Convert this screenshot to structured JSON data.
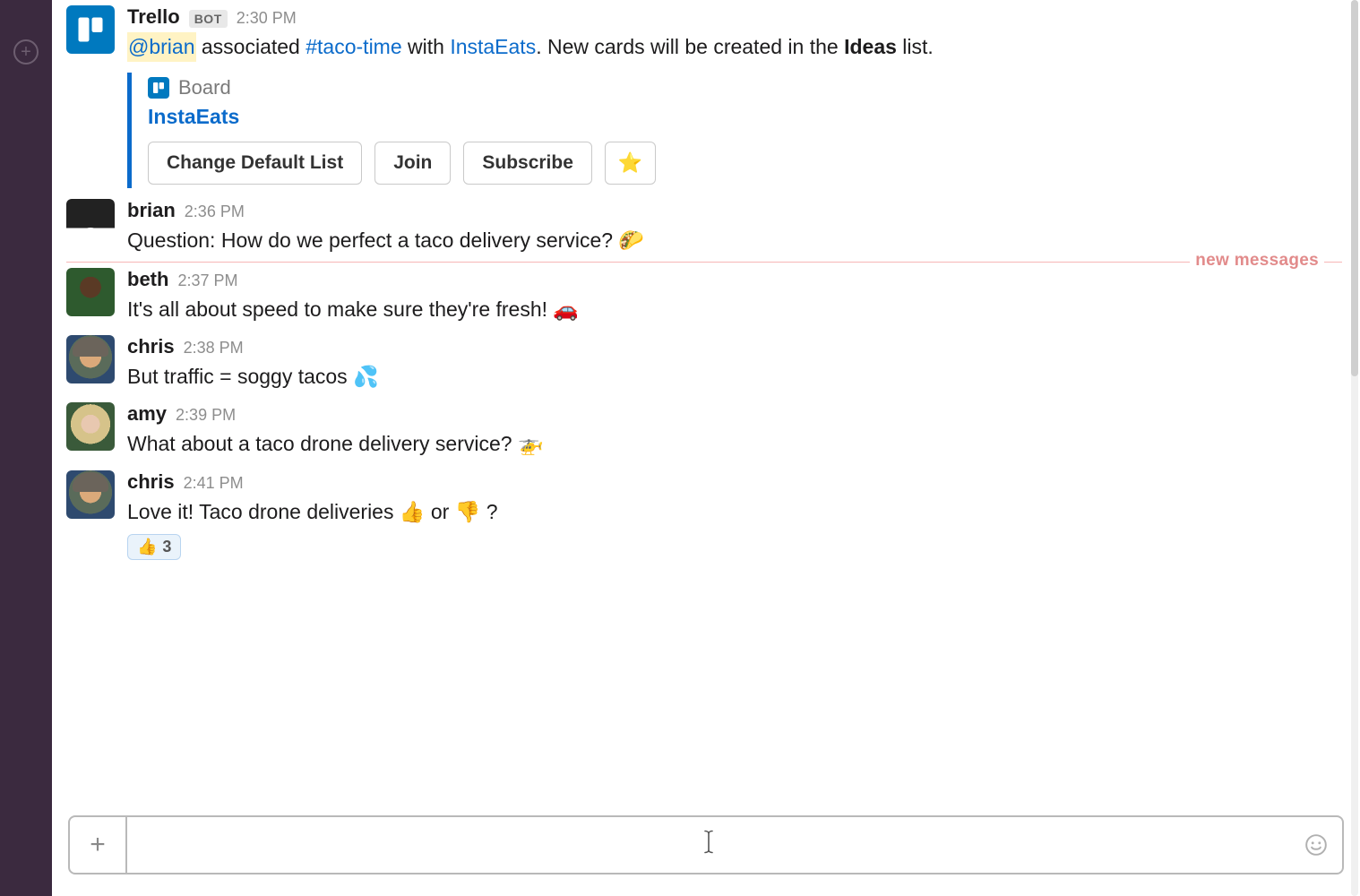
{
  "sidebar": {
    "add_label": "+"
  },
  "messages": [
    {
      "id": "m0",
      "author": "Trello",
      "is_app": true,
      "app_badge": "BOT",
      "time": "2:30 PM",
      "avatar": "trello",
      "rich_text": {
        "mention": "@brian",
        "t1": " associated ",
        "channel": "#taco-time",
        "t2": " with ",
        "link": "InstaEats",
        "t3": ". New cards will be created in the ",
        "bold": "Ideas",
        "t4": " list."
      },
      "attachment": {
        "icon": "trello",
        "type_label": "Board",
        "name": "InstaEats",
        "buttons": {
          "change": "Change Default List",
          "join": "Join",
          "subscribe": "Subscribe",
          "star": "⭐"
        }
      }
    },
    {
      "id": "m1",
      "author": "brian",
      "time": "2:36 PM",
      "avatar": "brian",
      "text": "Question: How do we perfect a taco delivery service? 🌮"
    }
  ],
  "new_divider": {
    "label": "new messages"
  },
  "messages_after": [
    {
      "id": "m2",
      "author": "beth",
      "time": "2:37 PM",
      "avatar": "beth",
      "text": "It's all about speed to make sure they're fresh! 🚗"
    },
    {
      "id": "m3",
      "author": "chris",
      "time": "2:38 PM",
      "avatar": "chris",
      "text": "But traffic = soggy tacos 💦"
    },
    {
      "id": "m4",
      "author": "amy",
      "time": "2:39 PM",
      "avatar": "amy",
      "text": "What about a taco drone delivery service? 🚁"
    },
    {
      "id": "m5",
      "author": "chris",
      "time": "2:41 PM",
      "avatar": "chris",
      "text": "Love it! Taco drone deliveries 👍  or 👎  ?",
      "reaction": {
        "emoji": "👍",
        "count": "3"
      }
    }
  ],
  "composer": {
    "placeholder": "",
    "add_label": "+"
  }
}
